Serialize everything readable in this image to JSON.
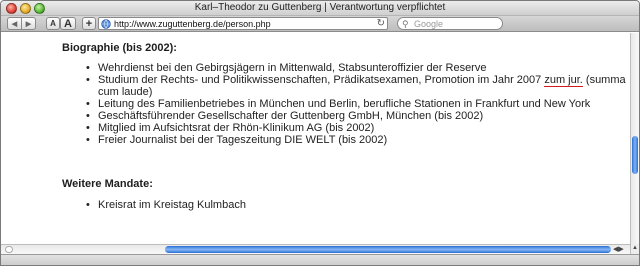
{
  "window": {
    "title": "Karl–Theodor zu Guttenberg | Verantwortung verpflichtet"
  },
  "toolbar": {
    "back_icon": "◀",
    "forward_icon": "▶",
    "text_smaller": "A",
    "text_larger": "A",
    "add_bookmark": "+",
    "url": "http://www.zuguttenberg.de/person.php",
    "reload_icon": "↻",
    "search_placeholder": "Google",
    "search_icon": "⚲"
  },
  "content": {
    "biography_heading": "Biographie (bis 2002):",
    "biography_items": [
      "Wehrdienst bei den Gebirgsjägern in Mittenwald, Stabsunteroffizier der Reserve",
      "Leitung des Familienbetriebes in München und Berlin, berufliche Stationen in Frankfurt und New York",
      "Geschäftsführender Gesellschafter der Guttenberg GmbH, München (bis 2002)",
      "Mitglied im Aufsichtsrat der Rhön-Klinikum AG (bis 2002)",
      "Freier Journalist bei der Tageszeitung DIE WELT (bis 2002)"
    ],
    "studium_item": {
      "before": "Studium der Rechts- und Politikwissenschaften, Prädikatsexamen, Promotion im Jahr 2007 ",
      "underlined": "zum jur.",
      "after": " (summa cum laude)"
    },
    "mandates_heading": "Weitere Mandate:",
    "mandates_items": [
      "Kreisrat im Kreistag Kulmbach"
    ]
  },
  "colors": {
    "accent": "#2a6fd6",
    "underline": "#d21a1a"
  }
}
